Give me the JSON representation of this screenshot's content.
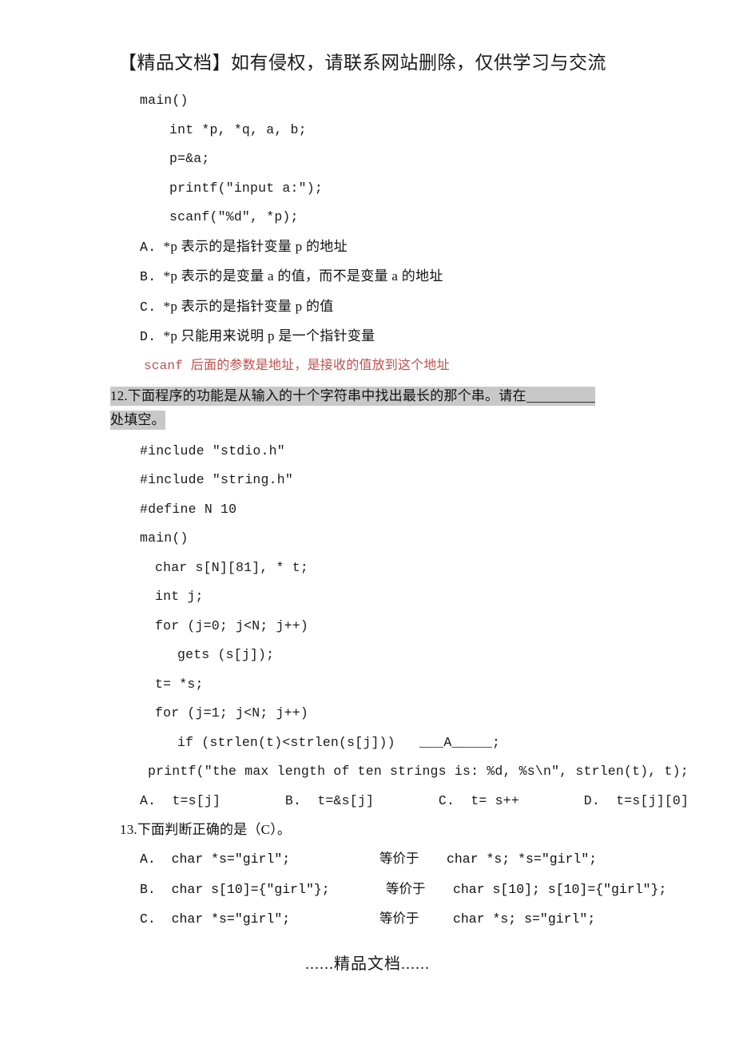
{
  "document": {
    "header_notice": "【精品文档】如有侵权，请联系网站删除，仅供学习与交流",
    "footer_note": "......精品文档......"
  },
  "question_11_code": [
    {
      "indent": "ind0",
      "text": "main()"
    },
    {
      "indent": "ind1",
      "text": "int *p, *q, a, b;"
    },
    {
      "indent": "ind1",
      "text": "p=&a;"
    },
    {
      "indent": "ind1",
      "text": "printf(″input a:″);"
    },
    {
      "indent": "ind1",
      "text": "scanf(″%d″, *p);"
    }
  ],
  "question_11_options": [
    {
      "label": "A.",
      "text": "*p 表示的是指针变量 p 的地址"
    },
    {
      "label": "B.",
      "text": "*p 表示的是变量 a 的值，而不是变量 a 的地址"
    },
    {
      "label": "C.",
      "text": "*p 表示的是指针变量 p 的值"
    },
    {
      "label": "D.",
      "text": "*p 只能用来说明 p 是一个指针变量"
    }
  ],
  "annotation_red": "scanf 后面的参数是地址，是接收的值放到这个地址",
  "question_12": {
    "number": "12.",
    "prompt_part1": "下面程序的功能是从输入的十个字符串中找出最长的那个串。请在",
    "prompt_part2": "处填空。",
    "code": [
      {
        "indent": "ind0",
        "text": "#include ″stdio.h″"
      },
      {
        "indent": "ind0",
        "text": "#include ″string.h″"
      },
      {
        "indent": "ind0",
        "text": "#define N 10"
      },
      {
        "indent": "ind0",
        "text": "main()"
      },
      {
        "indent": "ind2",
        "text": "char s[N][81], * t;"
      },
      {
        "indent": "ind2",
        "text": "int j;"
      },
      {
        "indent": "ind2",
        "text": "for (j=0; j<N; j++)"
      },
      {
        "indent": "ind3",
        "text": "gets (s[j]);"
      },
      {
        "indent": "ind2",
        "text": "t= *s;"
      },
      {
        "indent": "ind2",
        "text": "for (j=1; j<N; j++)"
      },
      {
        "indent": "ind3",
        "text": "if (strlen(t)<strlen(s[j]))   ___A_____;"
      },
      {
        "indent": "ind4",
        "text": "printf(″the max length of ten strings is: %d, %s\\n″, strlen(t), t);"
      }
    ],
    "answers_line": [
      {
        "label": "A.",
        "text": "t=s[j]"
      },
      {
        "label": "B.",
        "text": "t=&s[j]"
      },
      {
        "label": "C.",
        "text": "t= s++"
      },
      {
        "label": "D.",
        "text": "t=s[j][0]"
      }
    ]
  },
  "question_13": {
    "number": "13.",
    "prompt": "下面判断正确的是（C）。",
    "rows": [
      {
        "label": "A.",
        "left": "char *s=″girl″;",
        "mid": "等价于",
        "right": "char *s; *s=″girl″;"
      },
      {
        "label": "B.",
        "left": "char s[10]={″girl″};",
        "mid": "等价于",
        "right": "char s[10]; s[10]={″girl″};"
      },
      {
        "label": "C.",
        "left": "char *s=″girl″;",
        "mid": "等价于",
        "right": "char *s; s=″girl″;"
      }
    ]
  }
}
